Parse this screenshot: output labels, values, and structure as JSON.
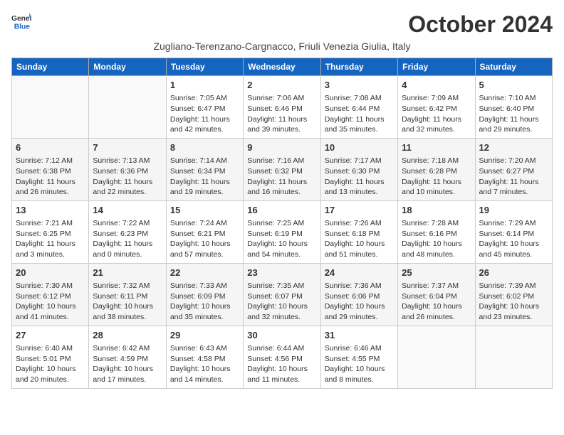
{
  "header": {
    "logo_line1": "General",
    "logo_line2": "Blue",
    "month_title": "October 2024",
    "location": "Zugliano-Terenzano-Cargnacco, Friuli Venezia Giulia, Italy"
  },
  "days_of_week": [
    "Sunday",
    "Monday",
    "Tuesday",
    "Wednesday",
    "Thursday",
    "Friday",
    "Saturday"
  ],
  "weeks": [
    [
      {
        "day": "",
        "info": ""
      },
      {
        "day": "",
        "info": ""
      },
      {
        "day": "1",
        "info": "Sunrise: 7:05 AM\nSunset: 6:47 PM\nDaylight: 11 hours and 42 minutes."
      },
      {
        "day": "2",
        "info": "Sunrise: 7:06 AM\nSunset: 6:46 PM\nDaylight: 11 hours and 39 minutes."
      },
      {
        "day": "3",
        "info": "Sunrise: 7:08 AM\nSunset: 6:44 PM\nDaylight: 11 hours and 35 minutes."
      },
      {
        "day": "4",
        "info": "Sunrise: 7:09 AM\nSunset: 6:42 PM\nDaylight: 11 hours and 32 minutes."
      },
      {
        "day": "5",
        "info": "Sunrise: 7:10 AM\nSunset: 6:40 PM\nDaylight: 11 hours and 29 minutes."
      }
    ],
    [
      {
        "day": "6",
        "info": "Sunrise: 7:12 AM\nSunset: 6:38 PM\nDaylight: 11 hours and 26 minutes."
      },
      {
        "day": "7",
        "info": "Sunrise: 7:13 AM\nSunset: 6:36 PM\nDaylight: 11 hours and 22 minutes."
      },
      {
        "day": "8",
        "info": "Sunrise: 7:14 AM\nSunset: 6:34 PM\nDaylight: 11 hours and 19 minutes."
      },
      {
        "day": "9",
        "info": "Sunrise: 7:16 AM\nSunset: 6:32 PM\nDaylight: 11 hours and 16 minutes."
      },
      {
        "day": "10",
        "info": "Sunrise: 7:17 AM\nSunset: 6:30 PM\nDaylight: 11 hours and 13 minutes."
      },
      {
        "day": "11",
        "info": "Sunrise: 7:18 AM\nSunset: 6:28 PM\nDaylight: 11 hours and 10 minutes."
      },
      {
        "day": "12",
        "info": "Sunrise: 7:20 AM\nSunset: 6:27 PM\nDaylight: 11 hours and 7 minutes."
      }
    ],
    [
      {
        "day": "13",
        "info": "Sunrise: 7:21 AM\nSunset: 6:25 PM\nDaylight: 11 hours and 3 minutes."
      },
      {
        "day": "14",
        "info": "Sunrise: 7:22 AM\nSunset: 6:23 PM\nDaylight: 11 hours and 0 minutes."
      },
      {
        "day": "15",
        "info": "Sunrise: 7:24 AM\nSunset: 6:21 PM\nDaylight: 10 hours and 57 minutes."
      },
      {
        "day": "16",
        "info": "Sunrise: 7:25 AM\nSunset: 6:19 PM\nDaylight: 10 hours and 54 minutes."
      },
      {
        "day": "17",
        "info": "Sunrise: 7:26 AM\nSunset: 6:18 PM\nDaylight: 10 hours and 51 minutes."
      },
      {
        "day": "18",
        "info": "Sunrise: 7:28 AM\nSunset: 6:16 PM\nDaylight: 10 hours and 48 minutes."
      },
      {
        "day": "19",
        "info": "Sunrise: 7:29 AM\nSunset: 6:14 PM\nDaylight: 10 hours and 45 minutes."
      }
    ],
    [
      {
        "day": "20",
        "info": "Sunrise: 7:30 AM\nSunset: 6:12 PM\nDaylight: 10 hours and 41 minutes."
      },
      {
        "day": "21",
        "info": "Sunrise: 7:32 AM\nSunset: 6:11 PM\nDaylight: 10 hours and 38 minutes."
      },
      {
        "day": "22",
        "info": "Sunrise: 7:33 AM\nSunset: 6:09 PM\nDaylight: 10 hours and 35 minutes."
      },
      {
        "day": "23",
        "info": "Sunrise: 7:35 AM\nSunset: 6:07 PM\nDaylight: 10 hours and 32 minutes."
      },
      {
        "day": "24",
        "info": "Sunrise: 7:36 AM\nSunset: 6:06 PM\nDaylight: 10 hours and 29 minutes."
      },
      {
        "day": "25",
        "info": "Sunrise: 7:37 AM\nSunset: 6:04 PM\nDaylight: 10 hours and 26 minutes."
      },
      {
        "day": "26",
        "info": "Sunrise: 7:39 AM\nSunset: 6:02 PM\nDaylight: 10 hours and 23 minutes."
      }
    ],
    [
      {
        "day": "27",
        "info": "Sunrise: 6:40 AM\nSunset: 5:01 PM\nDaylight: 10 hours and 20 minutes."
      },
      {
        "day": "28",
        "info": "Sunrise: 6:42 AM\nSunset: 4:59 PM\nDaylight: 10 hours and 17 minutes."
      },
      {
        "day": "29",
        "info": "Sunrise: 6:43 AM\nSunset: 4:58 PM\nDaylight: 10 hours and 14 minutes."
      },
      {
        "day": "30",
        "info": "Sunrise: 6:44 AM\nSunset: 4:56 PM\nDaylight: 10 hours and 11 minutes."
      },
      {
        "day": "31",
        "info": "Sunrise: 6:46 AM\nSunset: 4:55 PM\nDaylight: 10 hours and 8 minutes."
      },
      {
        "day": "",
        "info": ""
      },
      {
        "day": "",
        "info": ""
      }
    ]
  ]
}
